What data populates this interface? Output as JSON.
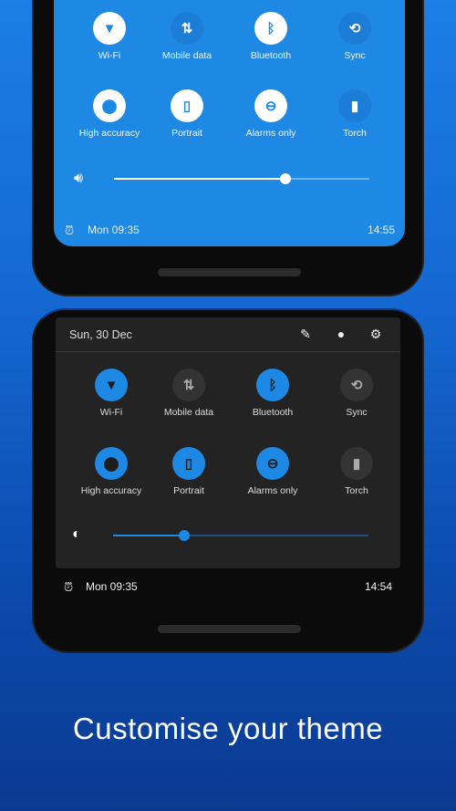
{
  "light_panel": {
    "tiles": [
      {
        "label": "Wi-Fi",
        "icon": "wifi-icon",
        "glyph": "▼",
        "active": true
      },
      {
        "label": "Mobile data",
        "icon": "mobile-data-icon",
        "glyph": "⇅",
        "active": false
      },
      {
        "label": "Bluetooth",
        "icon": "bluetooth-icon",
        "glyph": "ᛒ",
        "active": true
      },
      {
        "label": "Sync",
        "icon": "sync-disabled-icon",
        "glyph": "⟲",
        "active": false
      },
      {
        "label": "High accuracy",
        "icon": "location-icon",
        "glyph": "⬤",
        "active": true
      },
      {
        "label": "Portrait",
        "icon": "portrait-icon",
        "glyph": "▯",
        "active": true
      },
      {
        "label": "Alarms only",
        "icon": "do-not-disturb-icon",
        "glyph": "⊖",
        "active": true
      },
      {
        "label": "Torch",
        "icon": "torch-icon",
        "glyph": "▮",
        "active": false
      }
    ],
    "slider_icon": "volume-icon",
    "slider_value": 0.67,
    "alarm": "Mon 09:35",
    "time": "14:55"
  },
  "dark_panel": {
    "date": "Sun, 30 Dec",
    "tiles": [
      {
        "label": "Wi-Fi",
        "icon": "wifi-icon",
        "glyph": "▼",
        "active": true
      },
      {
        "label": "Mobile data",
        "icon": "mobile-data-icon",
        "glyph": "⇅",
        "active": false
      },
      {
        "label": "Bluetooth",
        "icon": "bluetooth-icon",
        "glyph": "ᛒ",
        "active": true
      },
      {
        "label": "Sync",
        "icon": "sync-disabled-icon",
        "glyph": "⟲",
        "active": false
      },
      {
        "label": "High accuracy",
        "icon": "location-icon",
        "glyph": "⬤",
        "active": true
      },
      {
        "label": "Portrait",
        "icon": "portrait-icon",
        "glyph": "▯",
        "active": true
      },
      {
        "label": "Alarms only",
        "icon": "do-not-disturb-icon",
        "glyph": "⊖",
        "active": true
      },
      {
        "label": "Torch",
        "icon": "torch-icon",
        "glyph": "▮",
        "active": false
      }
    ],
    "slider_icon": "brightness-icon",
    "slider_value": 0.28,
    "alarm": "Mon 09:35",
    "time": "14:54"
  },
  "caption": "Customise your theme",
  "colors": {
    "accent": "#1e88e5",
    "dark_panel": "#232323"
  }
}
